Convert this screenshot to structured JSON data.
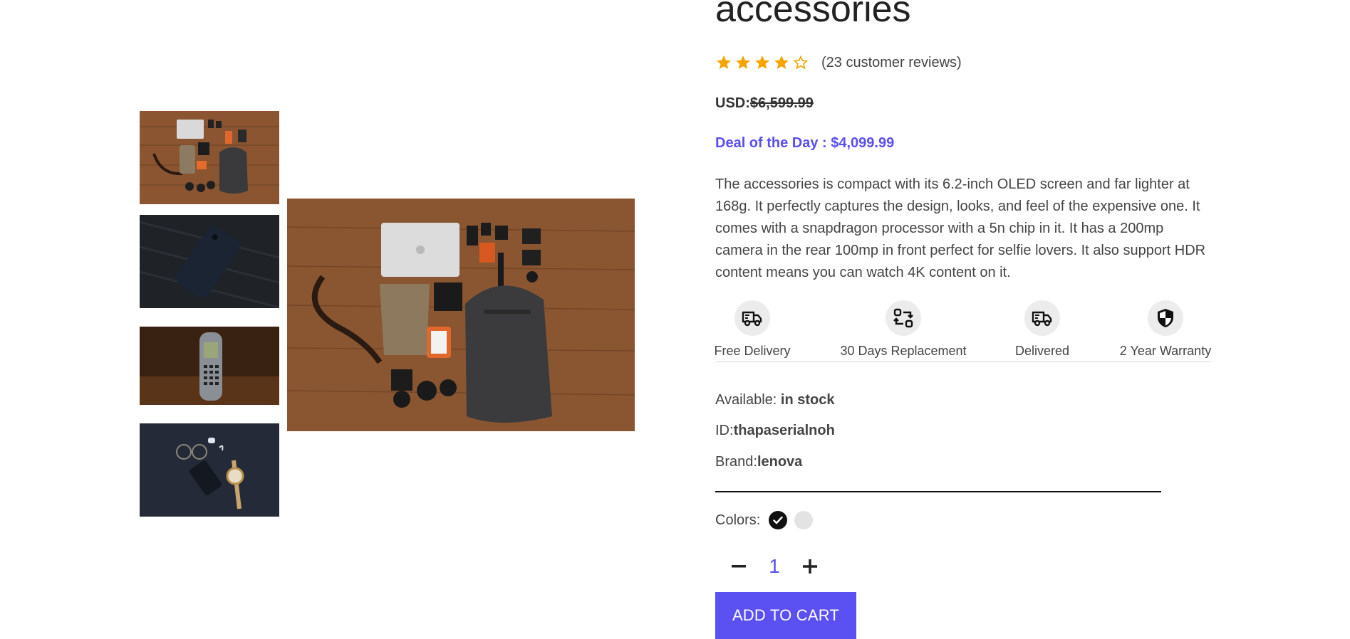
{
  "product": {
    "title": "accessories",
    "rating": 4,
    "rating_max": 5,
    "reviews_text": "(23 customer reviews)",
    "price_label": "USD:",
    "price_old": "$6,599.99",
    "deal_text": "Deal of the Day : $4,099.99",
    "description": "The accessories is compact with its 6.2-inch OLED screen and far lighter at 168g. It perfectly captures the design, looks, and feel of the expensive one. It comes with a snapdragon processor with a 5n chip in it. It has a 200mp camera in the rear 100mp in front perfect for selfie lovers. It also support HDR content means you can watch 4K content on it.",
    "available_label": "Available: ",
    "available_value": "in stock",
    "id_label": "ID:",
    "id_value": "thapaserialnoh",
    "brand_label": "Brand:",
    "brand_value": "lenova",
    "colors_label": "Colors:",
    "colors": [
      "#000000",
      "#e3e3e3"
    ],
    "selected_color": "#000000",
    "quantity": "1",
    "cta": "ADD TO CART"
  },
  "services": [
    {
      "label": "Free Delivery",
      "icon": "truck-icon"
    },
    {
      "label": "30 Days Replacement",
      "icon": "replace-icon"
    },
    {
      "label": "Delivered",
      "icon": "truck-icon"
    },
    {
      "label": "2 Year Warranty",
      "icon": "shield-icon"
    }
  ],
  "gallery": {
    "thumbnails": [
      "bag-flatlay",
      "phone-dark",
      "nokia-phone",
      "watch-flatlay"
    ],
    "selected": "bag-flatlay"
  },
  "colors": {
    "accent": "#5b50f2",
    "star": "#f6a400"
  }
}
